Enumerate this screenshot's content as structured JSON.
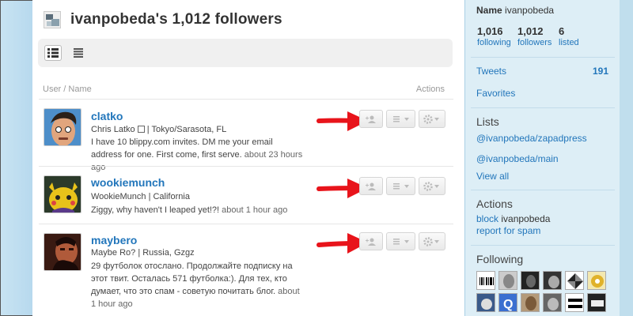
{
  "header": {
    "title": "ivanpobeda's 1,012 followers"
  },
  "columns": {
    "user_name": "User / Name",
    "actions": "Actions"
  },
  "users": [
    {
      "username": "clatko",
      "full_name": "Chris Latko",
      "location": "| Tokyo/Sarasota, FL",
      "bio": "I have 10 blippy.com invites. DM me your email address for one. First come, first serve.",
      "time_ago": "about 23 hours ago"
    },
    {
      "username": "wookiemunch",
      "full_name": "WookieMunch",
      "location": "| California",
      "bio": "Ziggy, why haven't I leaped yet!?!",
      "time_ago": "about 1 hour ago"
    },
    {
      "username": "maybero",
      "full_name": "Maybe Ro?",
      "location": "| Russia, Gzgz",
      "bio": "29 футболок отослано. Продолжайте подписку на этот твит. Осталась 571 футболка:). Для тех, кто думает, что это спам - советую почитать блог.",
      "time_ago": "about 1 hour ago"
    }
  ],
  "sidebar": {
    "name_label": "Name",
    "name_value": "ivanpobeda",
    "stats": [
      {
        "number": "1,016",
        "label": "following"
      },
      {
        "number": "1,012",
        "label": "followers"
      },
      {
        "number": "6",
        "label": "listed"
      }
    ],
    "tweets_label": "Tweets",
    "tweets_count": "191",
    "favorites_label": "Favorites",
    "lists_heading": "Lists",
    "lists": [
      "@ivanpobeda/zapadpress",
      "@ivanpobeda/main"
    ],
    "view_all": "View all",
    "actions_heading": "Actions",
    "block_label": "block",
    "block_user": "ivanpobeda",
    "report_spam": "report for spam",
    "following_heading": "Following"
  },
  "colors": {
    "link": "#2276bb",
    "arrow": "#e8141b",
    "page_bg": "#c0deed"
  },
  "icons": [
    "user-avatar",
    "list-view-icon",
    "compact-view-icon",
    "add-user-icon",
    "list-menu-icon",
    "gear-icon",
    "red-arrow"
  ]
}
